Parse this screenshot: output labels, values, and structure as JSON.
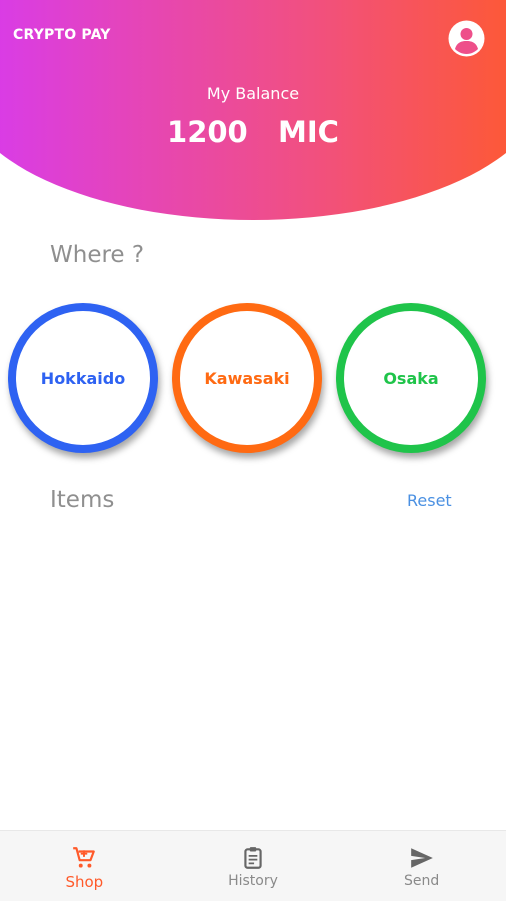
{
  "header": {
    "app_title": "CRYPTO PAY",
    "balance_label": "My Balance",
    "balance_amount": "1200",
    "balance_unit": "MIC",
    "gradient_colors": [
      "#d63af2",
      "#ff5a2a"
    ]
  },
  "where": {
    "heading": "Where ?",
    "locations": [
      {
        "label": "Hokkaido",
        "color": "#2e62f2"
      },
      {
        "label": "Kawasaki",
        "color": "#ff6a12"
      },
      {
        "label": "Osaka",
        "color": "#1fc44a"
      }
    ]
  },
  "items": {
    "heading": "Items",
    "reset_label": "Reset"
  },
  "bottom_nav": {
    "tabs": [
      {
        "label": "Shop",
        "icon": "cart-icon",
        "active": true
      },
      {
        "label": "History",
        "icon": "clipboard-icon",
        "active": false
      },
      {
        "label": "Send",
        "icon": "send-icon",
        "active": false
      }
    ],
    "active_color": "#ff5a2a"
  }
}
